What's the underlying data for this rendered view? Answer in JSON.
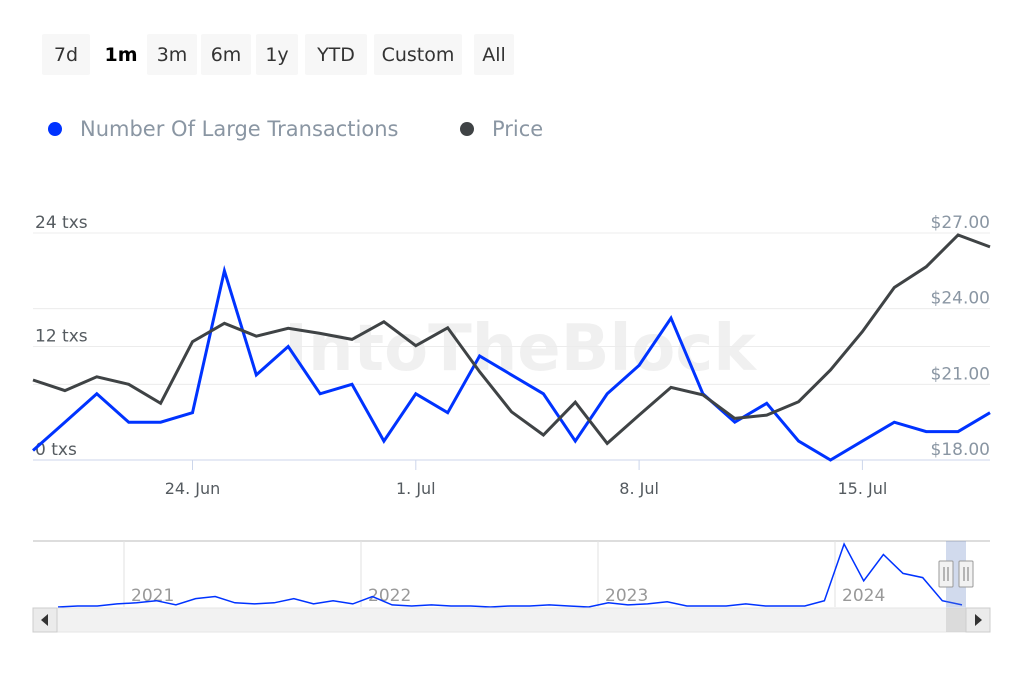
{
  "range_selector": {
    "buttons": [
      "7d",
      "1m",
      "3m",
      "6m",
      "1y",
      "YTD",
      "Custom",
      "All"
    ],
    "active": "1m"
  },
  "watermark": "IntoTheBlock",
  "colors": {
    "transactions": "#0033ff",
    "price": "#3f4345",
    "grid": "#ececec",
    "axis_label": "#555b60",
    "price_label": "#8a96a3"
  },
  "chart_data": {
    "type": "line",
    "title": "",
    "legend": {
      "placement": "top-left",
      "entries": [
        "Number Of Large Transactions",
        "Price"
      ]
    },
    "x": [
      "2024-06-19",
      "2024-06-20",
      "2024-06-21",
      "2024-06-22",
      "2024-06-23",
      "2024-06-24",
      "2024-06-25",
      "2024-06-26",
      "2024-06-27",
      "2024-06-28",
      "2024-06-29",
      "2024-06-30",
      "2024-07-01",
      "2024-07-02",
      "2024-07-03",
      "2024-07-04",
      "2024-07-05",
      "2024-07-06",
      "2024-07-07",
      "2024-07-08",
      "2024-07-09",
      "2024-07-10",
      "2024-07-11",
      "2024-07-12",
      "2024-07-13",
      "2024-07-14",
      "2024-07-15",
      "2024-07-16",
      "2024-07-17",
      "2024-07-18",
      "2024-07-19"
    ],
    "x_ticks": [
      {
        "date": "2024-06-24",
        "label": "24. Jun"
      },
      {
        "date": "2024-07-01",
        "label": "1. Jul"
      },
      {
        "date": "2024-07-08",
        "label": "8. Jul"
      },
      {
        "date": "2024-07-15",
        "label": "15. Jul"
      }
    ],
    "y_left": {
      "range": [
        0,
        24
      ],
      "ticks": [
        0,
        12,
        24
      ],
      "tick_labels": [
        "0 txs",
        "12 txs",
        "24 txs"
      ]
    },
    "y_right": {
      "range": [
        18,
        27
      ],
      "ticks": [
        18,
        21,
        24,
        27
      ],
      "tick_labels": [
        "$18.00",
        "$21.00",
        "$24.00",
        "$27.00"
      ]
    },
    "grid": true,
    "series": [
      {
        "name": "Number Of Large Transactions",
        "axis": "left",
        "color": "#0033ff",
        "values": [
          1,
          4,
          7,
          4,
          4,
          5,
          20,
          9,
          12,
          7,
          8,
          2,
          7,
          5,
          11,
          9,
          7,
          2,
          7,
          10,
          15,
          7,
          4,
          6,
          2,
          0,
          2,
          4,
          3,
          3,
          5
        ]
      },
      {
        "name": "Price",
        "axis": "right",
        "color": "#3f4345",
        "values": [
          21.17,
          20.75,
          21.3,
          21.0,
          20.25,
          22.69,
          23.42,
          22.91,
          23.22,
          23.02,
          22.78,
          23.48,
          22.53,
          23.24,
          21.5,
          19.91,
          18.99,
          20.29,
          18.66,
          19.78,
          20.88,
          20.58,
          19.65,
          19.78,
          20.31,
          21.57,
          23.09,
          24.84,
          25.66,
          26.92,
          26.45
        ]
      }
    ],
    "navigator": {
      "x_start": "2020-09",
      "x_end": "2024-07",
      "year_labels": [
        "2021",
        "2022",
        "2023",
        "2024"
      ],
      "values": [
        0,
        1,
        1,
        3,
        4,
        6,
        2,
        8,
        10,
        4,
        3,
        4,
        8,
        3,
        6,
        3,
        10,
        2,
        1,
        2,
        1,
        1,
        0,
        1,
        1,
        2,
        1,
        0,
        4,
        2,
        3,
        5,
        1,
        1,
        1,
        3,
        1,
        1,
        1,
        6,
        60,
        25,
        50,
        32,
        28,
        6,
        2
      ],
      "selected_range": [
        "2024-06-19",
        "2024-07-19"
      ]
    }
  }
}
